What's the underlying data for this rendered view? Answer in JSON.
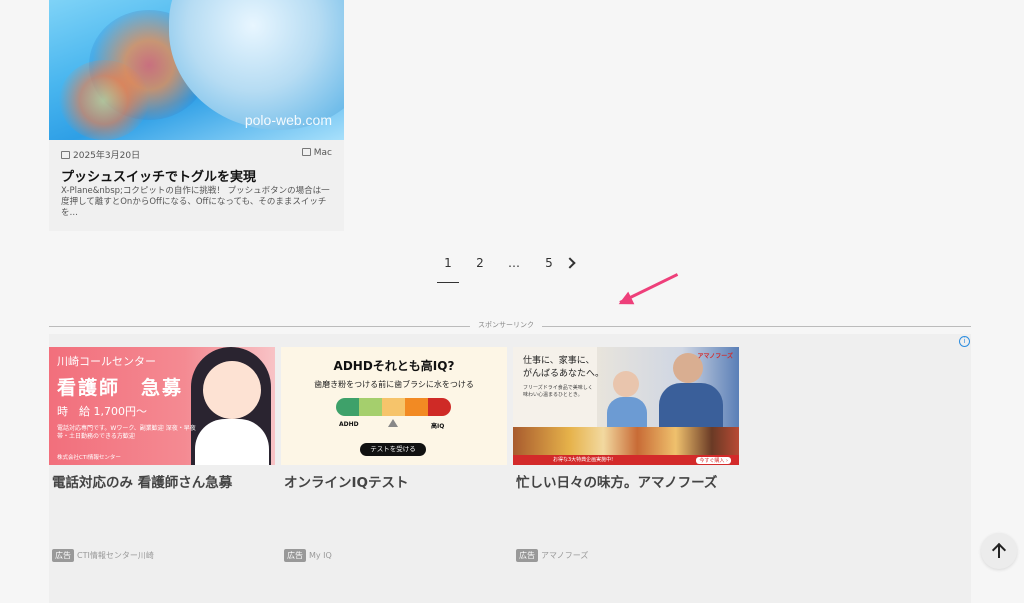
{
  "post": {
    "image_watermark": "polo-web.com",
    "date": "2025年3月20日",
    "category": "Mac",
    "title": "プッシュスイッチでトグルを実現",
    "excerpt": "X-Plane&nbsp;コクピットの自作に挑戦！ プッシュボタンの場合は一度押して離すとOnからOffになる、Offになっても、そのままスイッチを…"
  },
  "pagination": {
    "pages": [
      "1",
      "2",
      "…",
      "5"
    ],
    "current": "1"
  },
  "sponsor": {
    "label": "スポンサーリンク"
  },
  "ads": [
    {
      "image_text": {
        "line1": "川崎コールセンター",
        "line2": "看護師　急募",
        "line3": "時　給 1,700円〜",
        "line4": "電話対応専門です。Wワーク、副業歓迎 深夜・早夜帯・土日勤務のできる方歓迎",
        "company": "株式会社CTI情報センター"
      },
      "title": "電話対応のみ 看護師さん急募",
      "badge": "広告",
      "advertiser": "CTI情報センター川崎"
    },
    {
      "image_text": {
        "heading": "ADHDそれとも高IQ?",
        "sub": "歯磨き粉をつける前に歯ブラシに水をつける",
        "left": "ADHD",
        "right": "高IQ",
        "button": "テストを受ける"
      },
      "title": "オンラインIQテスト",
      "badge": "広告",
      "advertiser": "My IQ"
    },
    {
      "image_text": {
        "logo": "アマノフーズ",
        "line1": "仕事に、家事に、",
        "line2": "がんばるあなたへ。",
        "small": "フリーズドライ食品で美味しく味わい心温まるひととき。",
        "banner": "お得な3大特典企画実施中!",
        "cta": "今すぐ購入 ›"
      },
      "title": "忙しい日々の味方。アマノフーズ",
      "badge": "広告",
      "advertiser": "アマノフーズ"
    }
  ],
  "colors": {
    "accent_arrow": "#ee3f7a",
    "adchoices": "#2d8ee0",
    "iq_bar": [
      "#3ea16a",
      "#a5cf6d",
      "#f6c46b",
      "#f28a23",
      "#cf2a26"
    ]
  }
}
